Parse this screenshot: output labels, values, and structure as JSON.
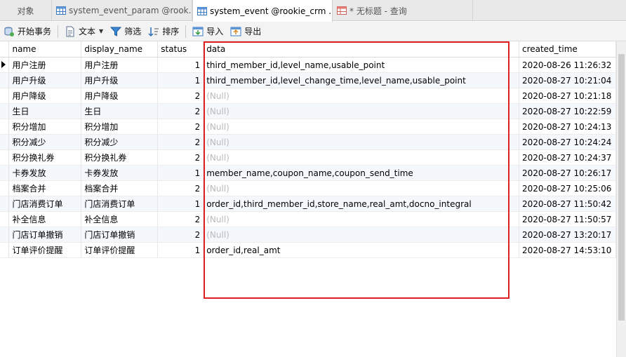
{
  "tabs": [
    {
      "label": "对象"
    },
    {
      "label": "system_event_param @rook..."
    },
    {
      "label": "system_event @rookie_crm ..."
    },
    {
      "label": "* 无标题 - 查询"
    }
  ],
  "toolbar": {
    "begin_transaction": "开始事务",
    "text": "文本",
    "filter": "筛选",
    "sort": "排序",
    "import": "导入",
    "export": "导出"
  },
  "columns": [
    "name",
    "display_name",
    "status",
    "data",
    "created_time"
  ],
  "rows": [
    {
      "name": "用户注册",
      "display_name": "用户注册",
      "status": "1",
      "data": "third_member_id,level_name,usable_point",
      "created_time": "2020-08-26 11:26:32"
    },
    {
      "name": "用户升级",
      "display_name": "用户升级",
      "status": "1",
      "data": "third_member_id,level_change_time,level_name,usable_point",
      "created_time": "2020-08-27 10:21:04"
    },
    {
      "name": "用户降级",
      "display_name": "用户降级",
      "status": "2",
      "data": "(Null)",
      "created_time": "2020-08-27 10:21:18"
    },
    {
      "name": "生日",
      "display_name": "生日",
      "status": "2",
      "data": "(Null)",
      "created_time": "2020-08-27 10:22:59"
    },
    {
      "name": "积分增加",
      "display_name": "积分增加",
      "status": "2",
      "data": "(Null)",
      "created_time": "2020-08-27 10:24:13"
    },
    {
      "name": "积分减少",
      "display_name": "积分减少",
      "status": "2",
      "data": "(Null)",
      "created_time": "2020-08-27 10:24:24"
    },
    {
      "name": "积分换礼券",
      "display_name": "积分换礼券",
      "status": "2",
      "data": "(Null)",
      "created_time": "2020-08-27 10:24:37"
    },
    {
      "name": "卡券发放",
      "display_name": "卡券发放",
      "status": "1",
      "data": "member_name,coupon_name,coupon_send_time",
      "created_time": "2020-08-27 10:26:17"
    },
    {
      "name": "档案合并",
      "display_name": "档案合并",
      "status": "2",
      "data": "(Null)",
      "created_time": "2020-08-27 10:25:06"
    },
    {
      "name": "门店消费订单",
      "display_name": "门店消费订单",
      "status": "1",
      "data": "order_id,third_member_id,store_name,real_amt,docno_integral",
      "created_time": "2020-08-27 11:50:42"
    },
    {
      "name": "补全信息",
      "display_name": "补全信息",
      "status": "2",
      "data": "(Null)",
      "created_time": "2020-08-27 11:50:57"
    },
    {
      "name": "门店订单撤销",
      "display_name": "门店订单撤销",
      "status": "2",
      "data": "(Null)",
      "created_time": "2020-08-27 13:20:17"
    },
    {
      "name": "订单评价提醒",
      "display_name": "订单评价提醒",
      "status": "1",
      "data": "order_id,real_amt",
      "created_time": "2020-08-27 14:53:10"
    }
  ],
  "icons": {
    "table": "table-icon",
    "query": "query-icon",
    "transaction": "begin-transaction-icon",
    "text": "text-icon",
    "filter": "filter-icon",
    "sort": "sort-icon",
    "import": "import-icon",
    "export": "export-icon"
  },
  "colors": {
    "highlight_box": "#e02020",
    "null_text": "#b9b9b9",
    "alt_row": "#f4f8fd"
  }
}
